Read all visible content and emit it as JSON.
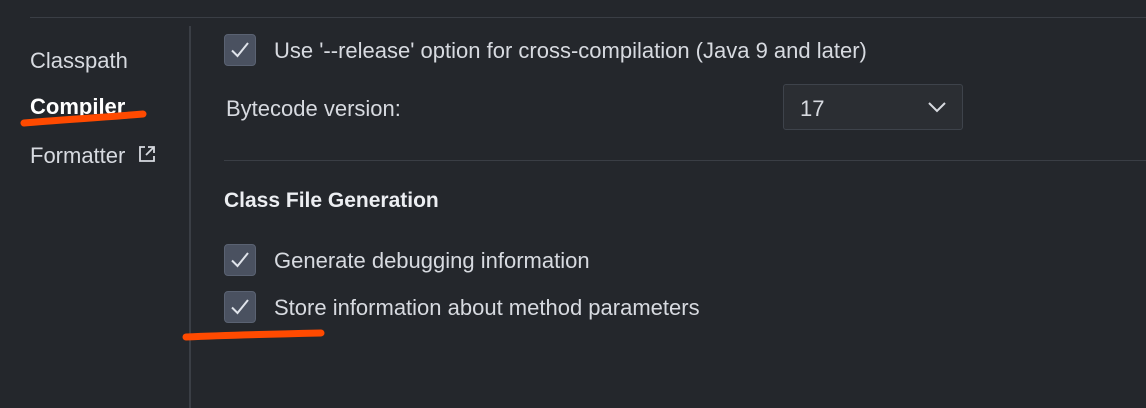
{
  "sidebar": {
    "items": [
      {
        "label": "Classpath"
      },
      {
        "label": "Compiler"
      },
      {
        "label": "Formatter"
      }
    ]
  },
  "compiler": {
    "release_option": {
      "label": "Use '--release' option for cross-compilation (Java 9 and later)",
      "checked": true
    },
    "bytecode_version": {
      "label": "Bytecode version:",
      "value": "17"
    },
    "class_file_generation": {
      "title": "Class File Generation",
      "options": [
        {
          "label": "Generate debugging information",
          "checked": true
        },
        {
          "label": "Store information about method parameters",
          "checked": true
        }
      ]
    }
  },
  "colors": {
    "background": "#24272c",
    "checkbox_fill": "#4a5160",
    "annotation": "#ff4a00"
  }
}
